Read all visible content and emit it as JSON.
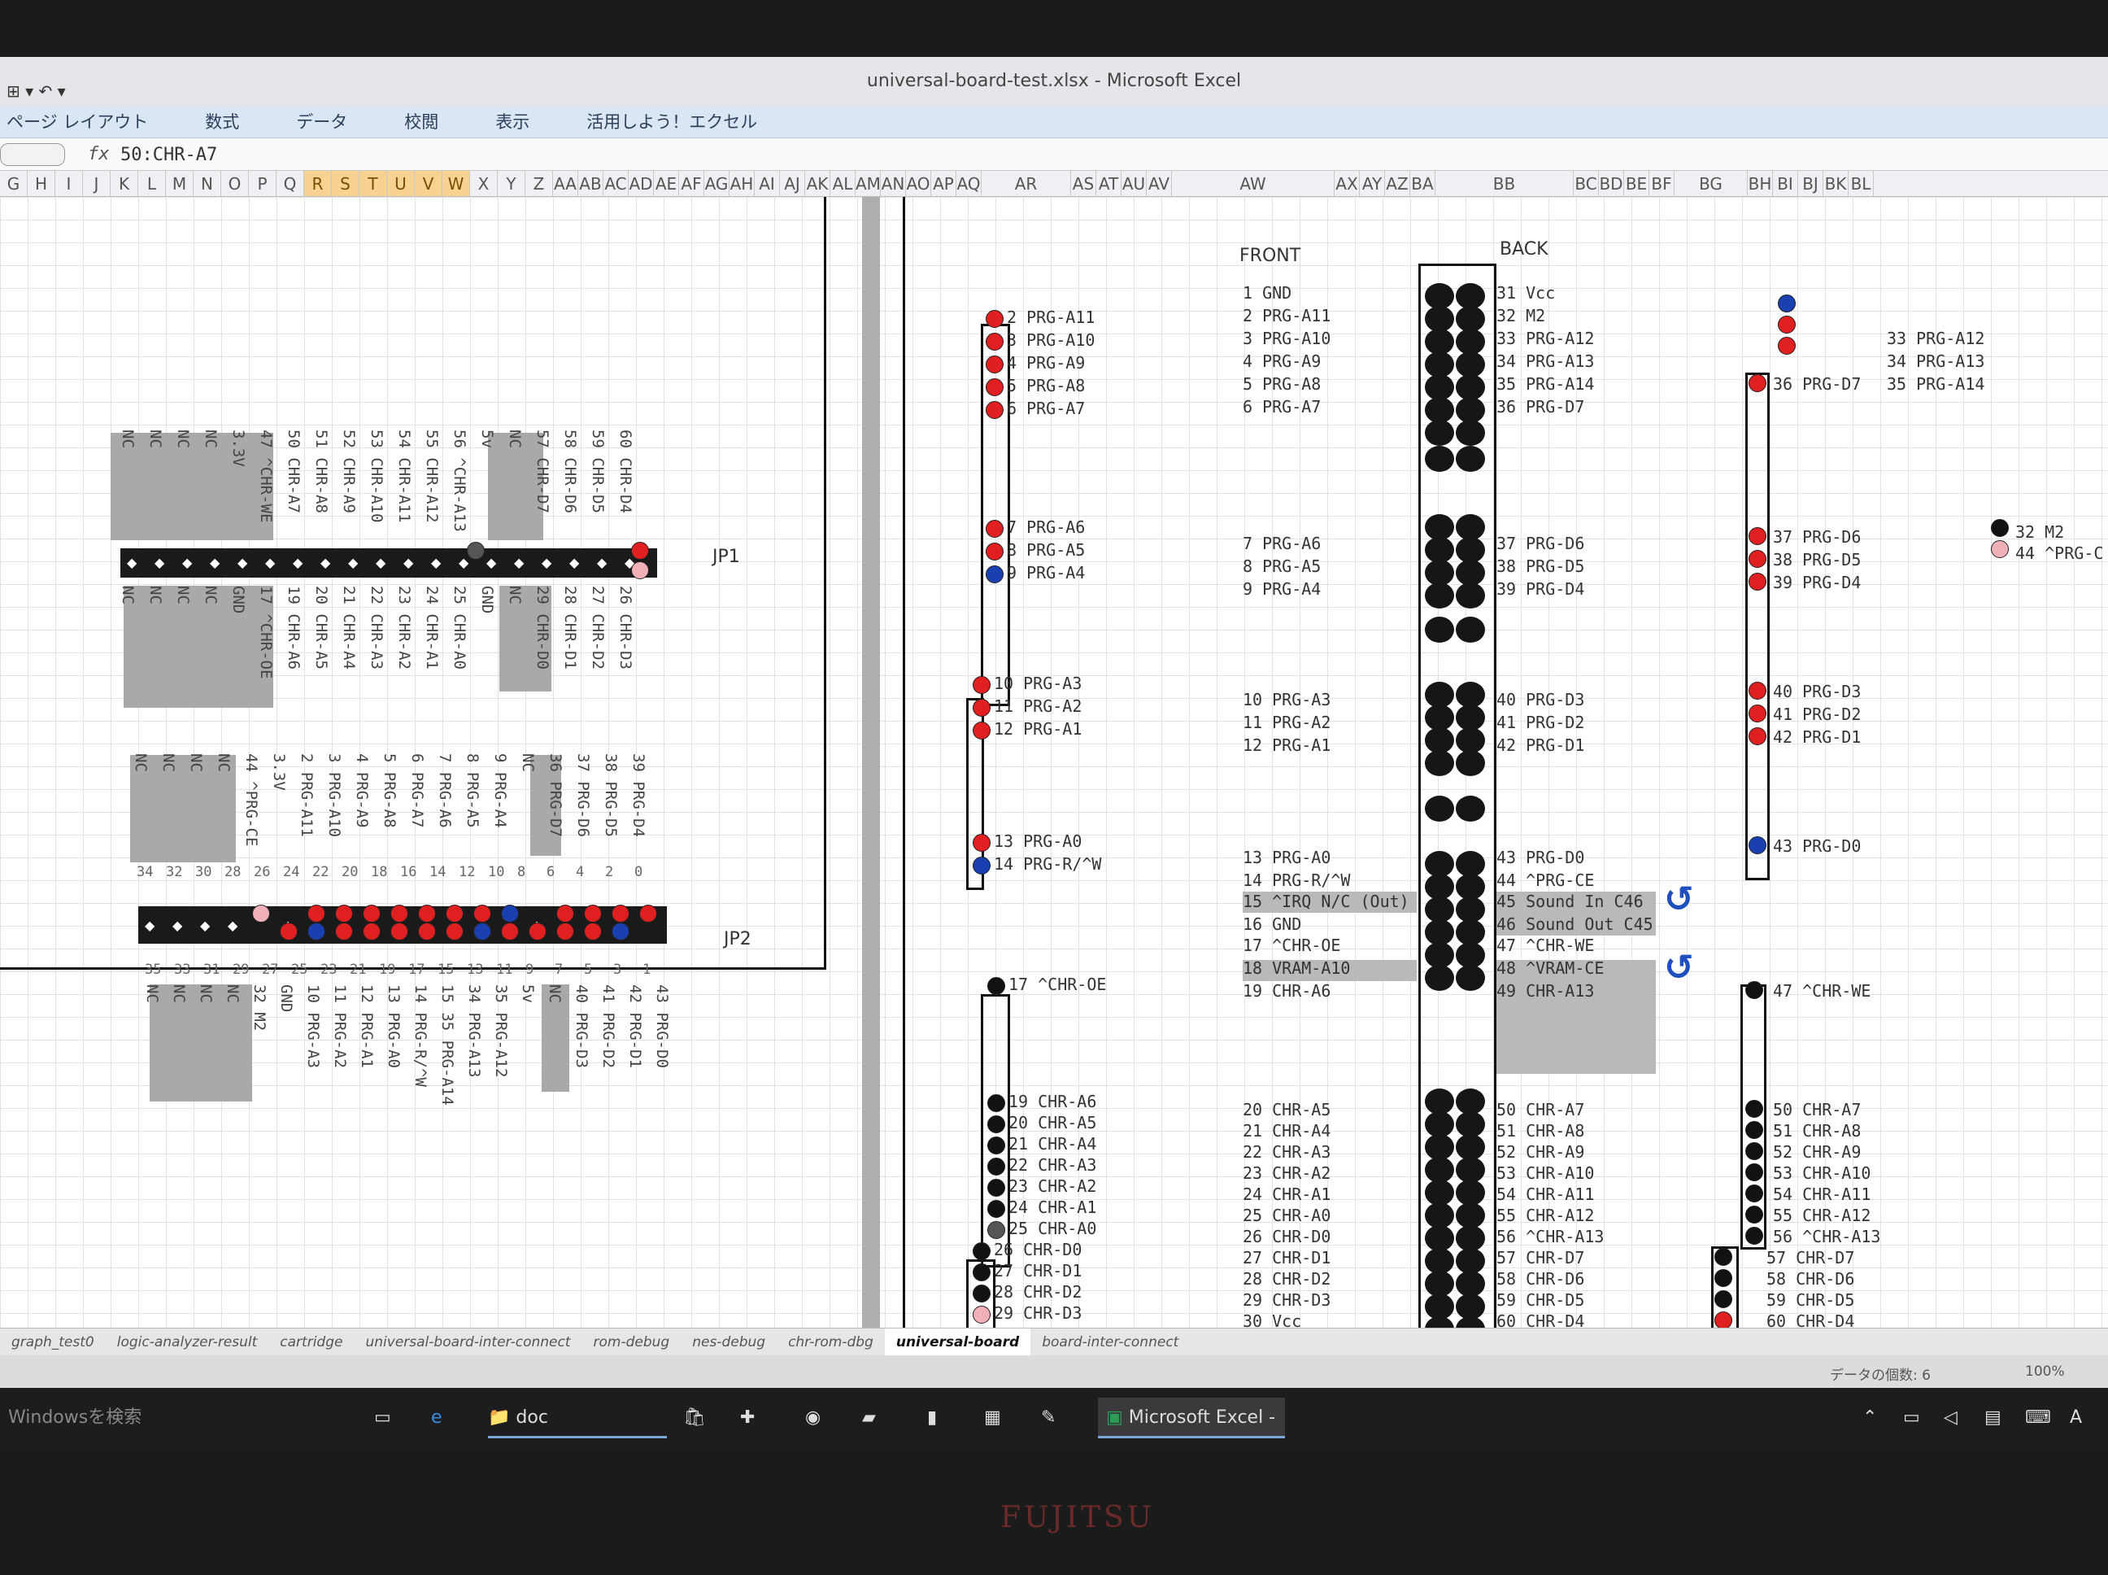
{
  "window": {
    "title": "universal-board-test.xlsx - Microsoft Excel"
  },
  "ribbon": {
    "tabs": [
      "ページ レイアウト",
      "数式",
      "データ",
      "校閲",
      "表示",
      "活用しよう！エクセル"
    ]
  },
  "formula_bar": {
    "fx": "fx",
    "value": "50:CHR-A7"
  },
  "column_headers": [
    "G",
    "H",
    "I",
    "J",
    "K",
    "L",
    "M",
    "N",
    "O",
    "P",
    "Q",
    "R",
    "S",
    "T",
    "U",
    "V",
    "W",
    "X",
    "Y",
    "Z",
    "AA",
    "AB",
    "AC",
    "AD",
    "AE",
    "AF",
    "AG",
    "AH",
    "AI",
    "AJ",
    "AK",
    "AL",
    "AM",
    "AN",
    "AO",
    "AP",
    "AQ",
    "AR",
    "AS",
    "AT",
    "AU",
    "AV",
    "AW",
    "AX",
    "AY",
    "AZ",
    "BA",
    "BB",
    "BC",
    "BD",
    "BE",
    "BF",
    "BG",
    "BH",
    "BI",
    "BJ",
    "BK",
    "BL"
  ],
  "highlighted_columns": [
    "R",
    "S",
    "T",
    "U",
    "V",
    "W"
  ],
  "left": {
    "jp1": "JP1",
    "jp2": "JP2",
    "jp1_top_labels": [
      "NC",
      "NC",
      "NC",
      "NC",
      "3.3V",
      "47 ^CHR-WE",
      "50 CHR-A7",
      "51 CHR-A8",
      "52 CHR-A9",
      "53 CHR-A10",
      "54 CHR-A11",
      "55 CHR-A12",
      "56 ^CHR-A13",
      "5v",
      "NC",
      "57 CHR-D7",
      "58 CHR-D6",
      "59 CHR-D5",
      "60 CHR-D4"
    ],
    "jp1_bottom_labels": [
      "NC",
      "NC",
      "NC",
      "NC",
      "GND",
      "17 ^CHR-OE",
      "19 CHR-A6",
      "20 CHR-A5",
      "21 CHR-A4",
      "22 CHR-A3",
      "23 CHR-A2",
      "24 CHR-A1",
      "25 CHR-A0",
      "GND",
      "NC",
      "29 CHR-D0",
      "28 CHR-D1",
      "27 CHR-D2",
      "26 CHR-D3"
    ],
    "jp2_top_labels": [
      "NC",
      "NC",
      "NC",
      "NC",
      "44 ^PRG-CE",
      "3.3V",
      "2 PRG-A11",
      "3 PRG-A10",
      "4 PRG-A9",
      "5 PRG-A8",
      "6 PRG-A7",
      "7 PRG-A6",
      "8 PRG-A5",
      "9 PRG-A4",
      "NC",
      "36 PRG-D7",
      "37 PRG-D6",
      "38 PRG-D5",
      "39 PRG-D4"
    ],
    "jp2_top_nums": [
      "34",
      "32",
      "30",
      "28",
      "26",
      "24",
      "22",
      "20",
      "18",
      "16",
      "14",
      "12",
      "10",
      "8",
      "6",
      "4",
      "2",
      "0"
    ],
    "jp2_bottom_labels": [
      "NC",
      "NC",
      "NC",
      "NC",
      "32 M2",
      "GND",
      "10 PRG-A3",
      "11 PRG-A2",
      "12 PRG-A1",
      "13 PRG-A0",
      "14 PRG-R/^W",
      "15 35 PRG-A14",
      "34 PRG-A13",
      "35 PRG-A12",
      "5v",
      "NC",
      "40 PRG-D3",
      "41 PRG-D2",
      "42 PRG-D1",
      "43 PRG-D0"
    ],
    "jp2_bottom_nums": [
      "35",
      "33",
      "31",
      "29",
      "27",
      "25",
      "23",
      "21",
      "19",
      "17",
      "15",
      "13",
      "11",
      "9",
      "7",
      "5",
      "3",
      "1"
    ]
  },
  "ar_labels": [
    "2 PRG-A11",
    "3 PRG-A10",
    "4 PRG-A9",
    "5 PRG-A8",
    "6 PRG-A7",
    "7 PRG-A6",
    "8 PRG-A5",
    "9 PRG-A4",
    "10 PRG-A3",
    "11 PRG-A2",
    "12 PRG-A1",
    "13 PRG-A0",
    "14 PRG-R/^W",
    "17 ^CHR-OE",
    "19 CHR-A6",
    "20 CHR-A5",
    "21 CHR-A4",
    "22 CHR-A3",
    "23 CHR-A2",
    "24 CHR-A1",
    "25 CHR-A0",
    "26 CHR-D0",
    "27 CHR-D1",
    "28 CHR-D2",
    "29 CHR-D3"
  ],
  "front": {
    "header": "FRONT",
    "labels": [
      "1 GND",
      "2 PRG-A11",
      "3 PRG-A10",
      "4 PRG-A9",
      "5 PRG-A8",
      "6 PRG-A7",
      "7 PRG-A6",
      "8 PRG-A5",
      "9 PRG-A4",
      "10 PRG-A3",
      "11 PRG-A2",
      "12 PRG-A1",
      "13 PRG-A0",
      "14 PRG-R/^W",
      "15 ^IRQ N/C (Out)",
      "16 GND",
      "17 ^CHR-OE",
      "18 VRAM-A10",
      "19 CHR-A6",
      "20 CHR-A5",
      "21 CHR-A4",
      "22 CHR-A3",
      "23 CHR-A2",
      "24 CHR-A1",
      "25 CHR-A0",
      "26 CHR-D0",
      "27 CHR-D1",
      "28 CHR-D2",
      "29 CHR-D3",
      "30 Vcc"
    ]
  },
  "back": {
    "header": "BACK",
    "labels": [
      "31 Vcc",
      "32 M2",
      "33 PRG-A12",
      "34 PRG-A13",
      "35 PRG-A14",
      "36 PRG-D7",
      "37 PRG-D6",
      "38 PRG-D5",
      "39 PRG-D4",
      "40 PRG-D3",
      "41 PRG-D2",
      "42 PRG-D1",
      "43 PRG-D0",
      "44 ^PRG-CE",
      "45 Sound In C46",
      "46 Sound Out C45",
      "47 ^CHR-WE",
      "48 ^VRAM-CE",
      "49 CHR-A13",
      "50 CHR-A7",
      "51 CHR-A8",
      "52 CHR-A9",
      "53 CHR-A10",
      "54 CHR-A11",
      "55 CHR-A12",
      "56 ^CHR-A13",
      "57 CHR-D7",
      "58 CHR-D6",
      "59 CHR-D5",
      "60 CHR-D4"
    ]
  },
  "bg_labels": [
    "36 PRG-D7",
    "37 PRG-D6",
    "38 PRG-D5",
    "39 PRG-D4",
    "40 PRG-D3",
    "41 PRG-D2",
    "42 PRG-D1",
    "43 PRG-D0",
    "47 ^CHR-WE",
    "50 CHR-A7",
    "51 CHR-A8",
    "52 CHR-A9",
    "53 CHR-A10",
    "54 CHR-A11",
    "55 CHR-A12",
    "56 ^CHR-A13",
    "57 CHR-D7",
    "58 CHR-D6",
    "59 CHR-D5",
    "60 CHR-D4"
  ],
  "bh_labels": [
    "33 PRG-A12",
    "34 PRG-A13",
    "35 PRG-A14"
  ],
  "bl_labels": [
    "32 M2",
    "44 ^PRG-C"
  ],
  "sheet_tabs": [
    "graph_test0",
    "logic-analyzer-result",
    "cartridge",
    "universal-board-inter-connect",
    "rom-debug",
    "nes-debug",
    "chr-rom-dbg",
    "universal-board",
    "board-inter-connect"
  ],
  "active_sheet": "universal-board",
  "status": {
    "left": "データの個数: 6",
    "zoom": "100%"
  },
  "taskbar": {
    "search": "Windowsを検索",
    "doc": "doc",
    "excel": "Microsoft Excel - u..."
  },
  "brand": "FUJITSU",
  "colors": {
    "red_pin": "#e02020",
    "blue_pin": "#1a3fb0",
    "black_pin": "#121212",
    "ribbon": "#dbe6f4",
    "highlight_col": "#f7d291"
  }
}
